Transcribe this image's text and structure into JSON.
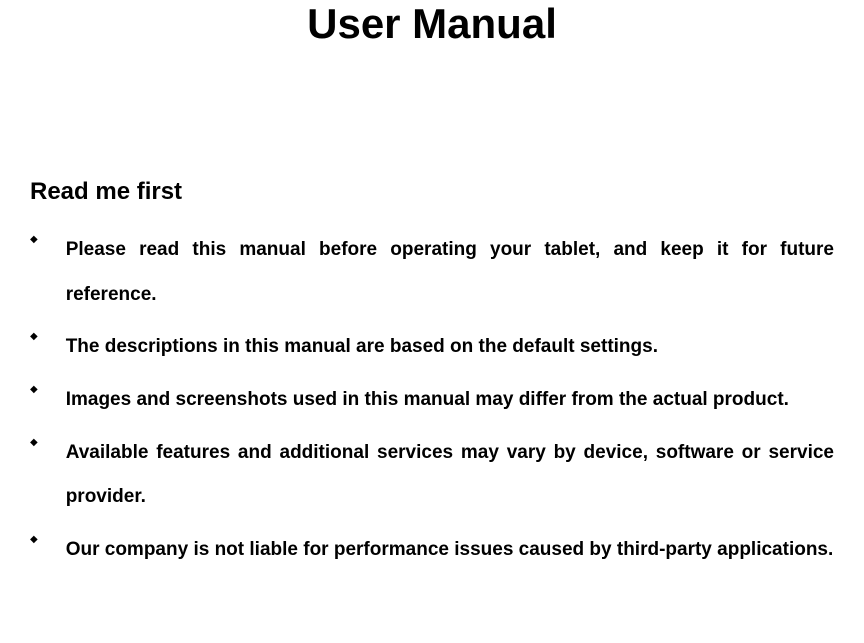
{
  "title": "User Manual",
  "section_heading": "Read me first",
  "bullets": [
    "Please read this manual before operating your tablet, and keep it for future reference.",
    "The descriptions in this manual are based on the default settings.",
    "Images and screenshots used in this manual may differ from the actual product.",
    "Available features and additional services may vary by device, software or service provider.",
    "Our company is not liable for performance issues caused by third-party applications."
  ]
}
